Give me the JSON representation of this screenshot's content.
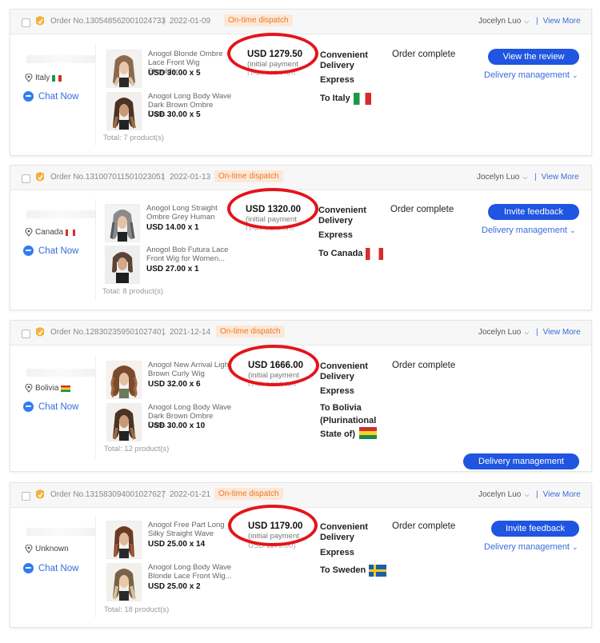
{
  "orders": [
    {
      "order_no": "Order No.130548562001024733",
      "date": "2022-01-09",
      "dispatch_badge": "On-time dispatch",
      "seller": "Jocelyn Luo",
      "view_more": "View More",
      "location": "Italy",
      "chat": "Chat Now",
      "products": [
        {
          "name": "Anogol Blonde Ombre Lace Front Wig Shoulder...",
          "price": "USD 30.00 x 5"
        },
        {
          "name": "Anogol Long Body Wave Dark Brown Ombre Dark...",
          "price": "USD 30.00 x 5"
        }
      ],
      "total": "Total:  7 product(s)",
      "amount": "USD 1279.50",
      "amount_note": "(initial payment",
      "amount_note2": "USD 1279.50)",
      "shipping": [
        "Convenient",
        "Delivery",
        "Express"
      ],
      "ship_to": "To Italy",
      "status": "Order complete",
      "action_button": "View the review",
      "delivery_link": "Delivery management"
    },
    {
      "order_no": "Order No.131007011501023051",
      "date": "2022-01-13",
      "dispatch_badge": "On-time dispatch",
      "seller": "Jocelyn Luo",
      "view_more": "View More",
      "location": "Canada",
      "chat": "Chat Now",
      "products": [
        {
          "name": "Anogol Long Straight Ombre Grey Human Blend",
          "price": "USD 14.00 x 1"
        },
        {
          "name": "Anogol Bob Futura Lace Front Wig for Women...",
          "price": "USD 27.00 x 1"
        }
      ],
      "total": "Total:  8 product(s)",
      "amount": "USD 1320.00",
      "amount_note": "(initial payment",
      "amount_note2": "USD 1320.00)",
      "shipping": [
        "Convenient",
        "Delivery",
        "Express"
      ],
      "ship_to": "To Canada",
      "status": "Order complete",
      "action_button": "Invite feedback",
      "delivery_link": "Delivery management"
    },
    {
      "order_no": "Order No.128302359501027401",
      "date": "2021-12-14",
      "dispatch_badge": "On-time dispatch",
      "seller": "Jocelyn Luo",
      "view_more": "View More",
      "location": "Bolivia",
      "chat": "Chat Now",
      "products": [
        {
          "name": "Anogol New Arrival Light Brown Curly Wig Synthetic",
          "price": "USD 32.00 x 6"
        },
        {
          "name": "Anogol Long Body Wave Dark Brown Ombre Dark...",
          "price": "USD 30.00 x 10"
        }
      ],
      "total": "Total:  12 product(s)",
      "amount": "USD 1666.00",
      "amount_note": "(initial payment",
      "amount_note2": "USD 1666.00)",
      "shipping": [
        "Convenient",
        "Delivery",
        "Express"
      ],
      "ship_to": "To Bolivia (Plurinational State of)",
      "status": "Order complete",
      "action_button": "Delivery management",
      "delivery_link": ""
    },
    {
      "order_no": "Order No.131583094001027627",
      "date": "2022-01-21",
      "dispatch_badge": "On-time dispatch",
      "seller": "Jocelyn Luo",
      "view_more": "View More",
      "location": "Unknown",
      "chat": "Chat Now",
      "products": [
        {
          "name": "Anogol Free Part Long Silky Straight Wave Ombre...",
          "price": "USD 25.00 x 14"
        },
        {
          "name": "Anogol Long Body Wave Blonde Lace Front Wig...",
          "price": "USD 25.00 x 2"
        }
      ],
      "total": "Total:  18 product(s)",
      "amount": "USD 1179.00",
      "amount_note": "(initial payment",
      "amount_note2": "USD 1179.00)",
      "shipping": [
        "Convenient",
        "Delivery",
        "Express"
      ],
      "ship_to": "To Sweden",
      "status": "Order complete",
      "action_button": "Invite feedback",
      "delivery_link": "Delivery management"
    }
  ],
  "colors": {
    "accent": "#1f55e0",
    "link": "#3a6bdc",
    "badge_bg": "#fde8d7",
    "badge_text": "#e77a2c",
    "highlight_ring": "#e4141b"
  }
}
